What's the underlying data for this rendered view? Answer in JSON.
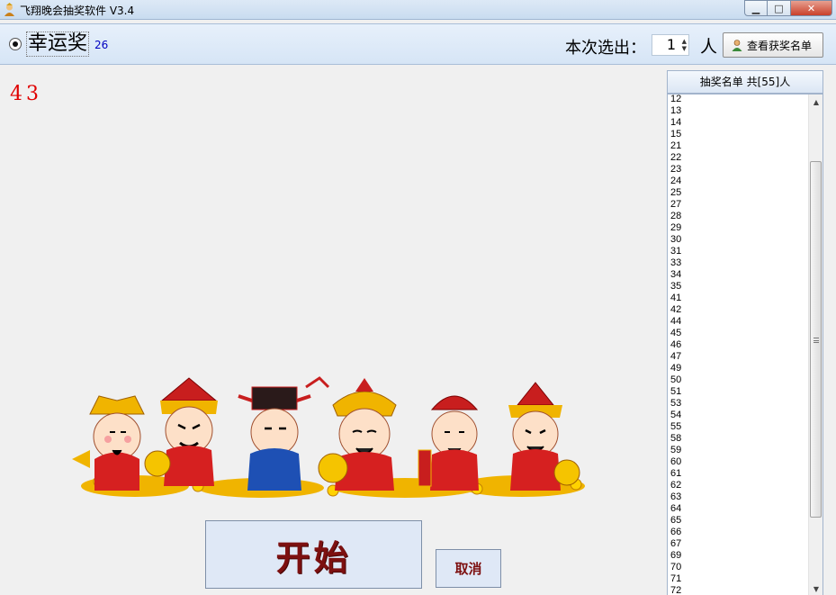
{
  "window": {
    "title": "飞翔晚会抽奖软件 V3.4",
    "min_glyph": "▁",
    "max_glyph": "□",
    "close_glyph": "✕"
  },
  "toolbar": {
    "prize_name": "幸运奖",
    "prize_count": "26",
    "pick_label": "本次选出：",
    "pick_value": "1",
    "person_label": "人",
    "view_winners_label": "查看获奖名单"
  },
  "main": {
    "counter": "43",
    "start_label": "开始",
    "cancel_label": "取消"
  },
  "list": {
    "header": "抽奖名单 共[55]人",
    "items": [
      "12",
      "13",
      "14",
      "15",
      "21",
      "22",
      "23",
      "24",
      "25",
      "27",
      "28",
      "29",
      "30",
      "31",
      "33",
      "34",
      "35",
      "41",
      "42",
      "44",
      "45",
      "46",
      "47",
      "49",
      "50",
      "51",
      "53",
      "54",
      "55",
      "58",
      "59",
      "60",
      "61",
      "62",
      "63",
      "64",
      "65",
      "66",
      "67",
      "69",
      "70",
      "71",
      "72"
    ]
  },
  "colors": {
    "counter": "#e00000",
    "start_text": "#7d1010",
    "accent_blue": "#0000c0"
  }
}
